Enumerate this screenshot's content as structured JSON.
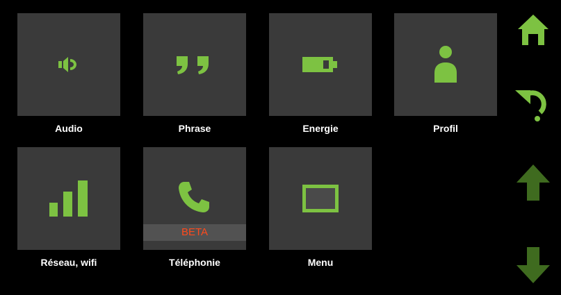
{
  "tiles": [
    {
      "label": "Audio",
      "icon": "speaker-icon"
    },
    {
      "label": "Phrase",
      "icon": "quote-icon"
    },
    {
      "label": "Energie",
      "icon": "battery-icon"
    },
    {
      "label": "Profil",
      "icon": "person-icon"
    },
    {
      "label": "Réseau, wifi",
      "icon": "signal-bars-icon"
    },
    {
      "label": "Téléphonie",
      "icon": "phone-icon",
      "badge": "BETA"
    },
    {
      "label": "Menu",
      "icon": "screen-icon"
    }
  ],
  "nav": [
    {
      "name": "home",
      "icon": "home-icon"
    },
    {
      "name": "back",
      "icon": "undo-arrow-icon"
    },
    {
      "name": "scroll-up",
      "icon": "arrow-up-icon"
    },
    {
      "name": "scroll-down",
      "icon": "arrow-down-icon"
    }
  ],
  "colors": {
    "background": "#000000",
    "tile": "#3a3a3a",
    "accent": "#7dc242",
    "accent_dim": "#3f6b1f",
    "beta_band": "#525252",
    "beta_text": "#ff4a1c",
    "label": "#ffffff"
  }
}
